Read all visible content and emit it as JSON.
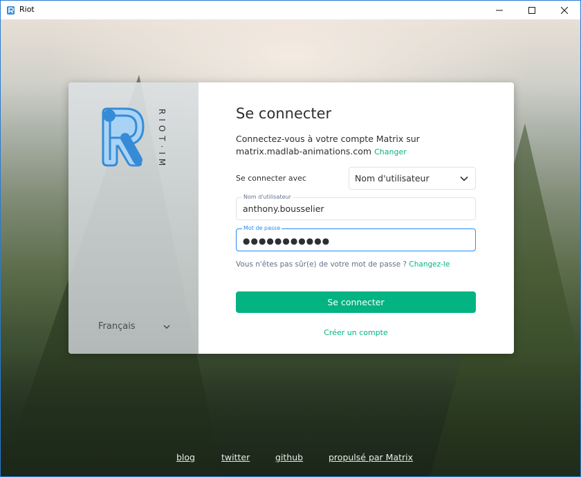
{
  "window": {
    "title": "Riot",
    "controls": {
      "minimize": "minimize-icon",
      "maximize": "maximize-icon",
      "close": "close-icon"
    }
  },
  "brand": {
    "wordmark": "RIOT·IM",
    "colors": {
      "accent": "#03b381",
      "logo_blue": "#368bd6",
      "focus_blue": "#238cf5"
    }
  },
  "sidebar": {
    "language": "Français"
  },
  "login": {
    "title": "Se connecter",
    "intro": "Connectez-vous à votre compte Matrix sur matrix.madlab-animations.com",
    "change_server": "Changer",
    "login_with_label": "Se connecter avec",
    "login_with_value": "Nom d'utilisateur",
    "username_label": "Nom d'utilisateur",
    "username_value": "anthony.bousselier",
    "password_label": "Mot de passe",
    "password_value": "●●●●●●●●●●●",
    "forgot_text": "Vous n'êtes pas sûr(e) de votre mot de passe ?",
    "forgot_link": "Changez-le",
    "submit": "Se connecter",
    "create_account": "Créer un compte"
  },
  "footer": {
    "links": [
      "blog",
      "twitter",
      "github",
      "propulsé par Matrix"
    ]
  }
}
